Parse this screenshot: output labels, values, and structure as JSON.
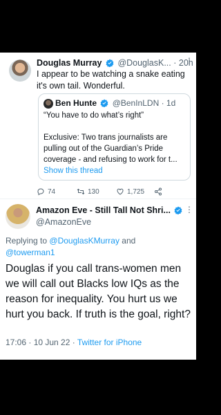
{
  "tweet1": {
    "display_name": "Douglas Murray",
    "handle": "@DouglasK...",
    "separator": "·",
    "time": "20h",
    "text": "I appear to be watching a snake eating it's own tail. Wonderful.",
    "quote": {
      "display_name": "Ben Hunte",
      "handle": "@BenInLDN",
      "separator": "·",
      "time": "1d",
      "line1": "“You have to do what’s right”",
      "line2": "Exclusive: Two trans journalists are pulling out of the Guardian’s Pride coverage - and refusing to work for t...",
      "show_thread": "Show this thread"
    },
    "actions": {
      "replies": "74",
      "retweets": "130",
      "likes": "1,725"
    }
  },
  "tweet2": {
    "display_name": "Amazon Eve - Still Tall Not Shri...",
    "handle": "@AmazonEve",
    "replying_prefix": "Replying to",
    "replying_user1": "@DouglasKMurray",
    "replying_and": "and",
    "replying_user2": "@towerman1",
    "body": "Douglas if you call trans-women men we will call out Blacks low IQs as the reason for inequality.  You hurt us we hurt you back.  If truth is the goal, right?",
    "timestamp": "17:06 · 10 Jun 22 · ",
    "source": "Twitter for iPhone"
  },
  "colors": {
    "accent": "#1d9bf0",
    "text": "#0f1419",
    "muted": "#536471",
    "background": "#000000"
  }
}
